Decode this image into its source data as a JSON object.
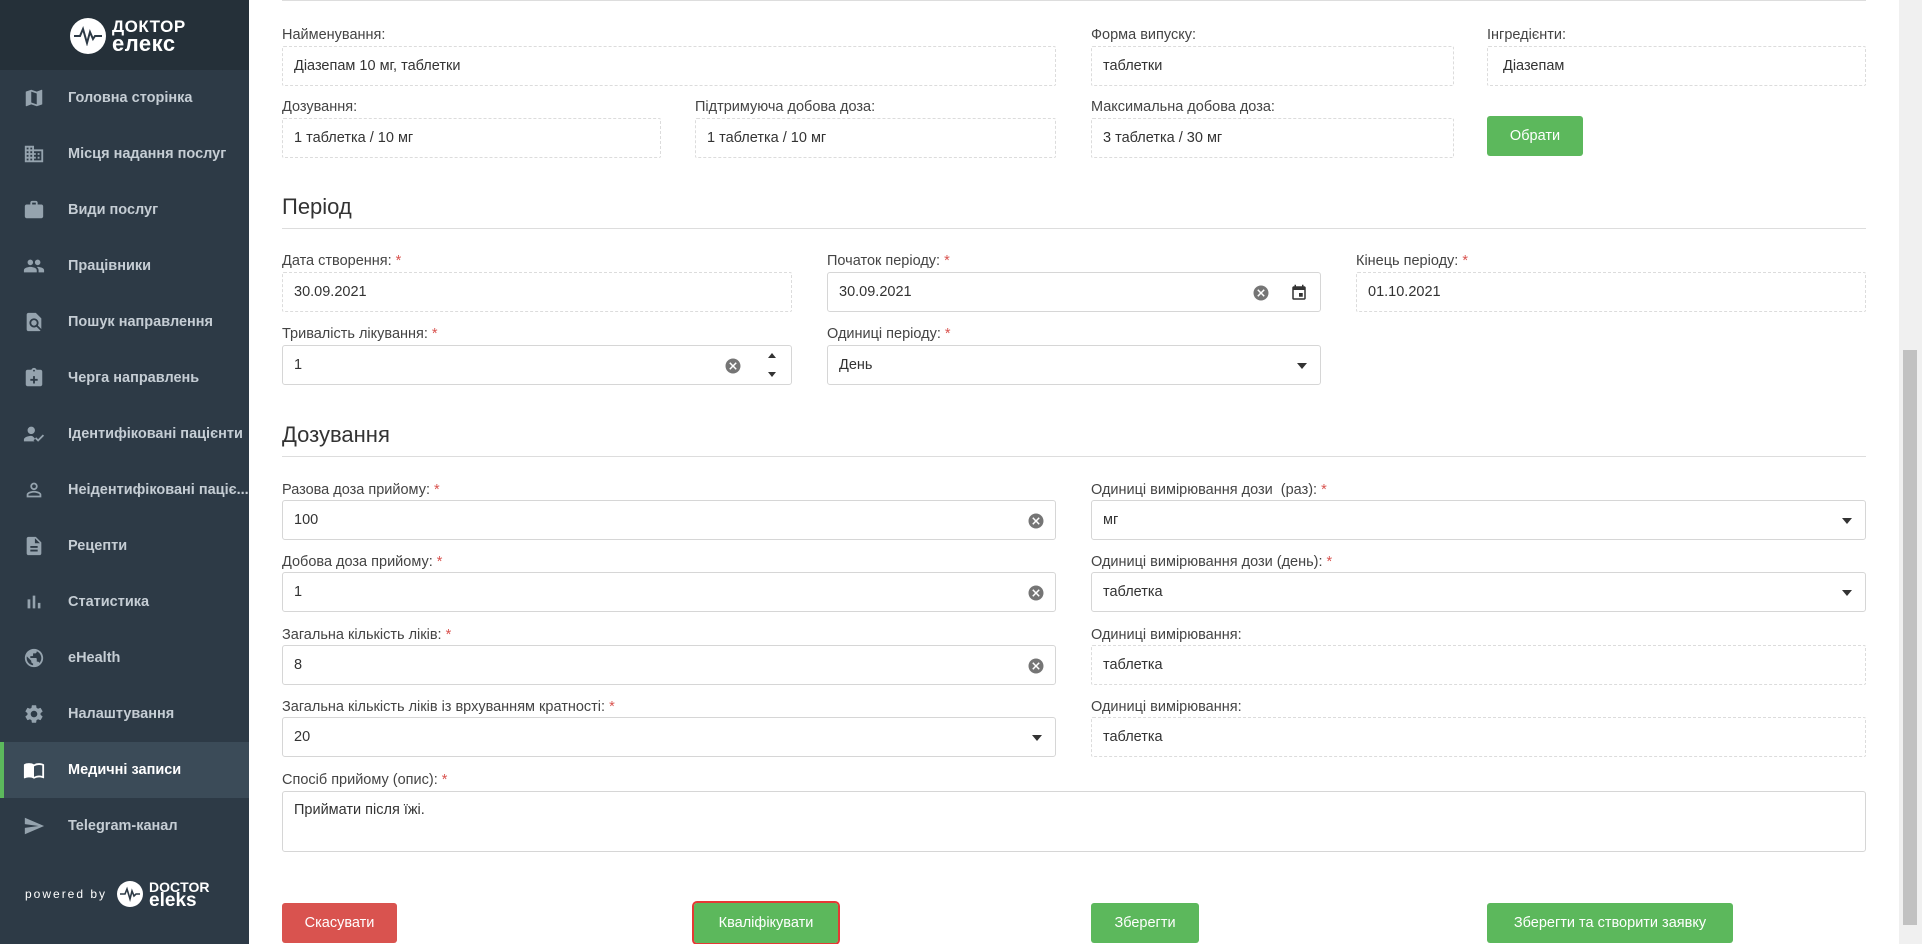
{
  "brand": {
    "line1": "ДОКТОР",
    "line2": "елекс",
    "powered_by": "powered by",
    "footer_line1": "DOCTOR",
    "footer_line2": "eleks"
  },
  "nav": [
    {
      "label": "Головна сторінка",
      "icon": "map-icon",
      "active": false
    },
    {
      "label": "Місця надання послуг",
      "icon": "building-icon",
      "active": false
    },
    {
      "label": "Види послуг",
      "icon": "briefcase-icon",
      "active": false
    },
    {
      "label": "Працівники",
      "icon": "people-icon",
      "active": false
    },
    {
      "label": "Пошук направлення",
      "icon": "document-search-icon",
      "active": false
    },
    {
      "label": "Черга направлень",
      "icon": "clipboard-plus-icon",
      "active": false
    },
    {
      "label": "Ідентифіковані пацієнти",
      "icon": "person-check-icon",
      "active": false
    },
    {
      "label": "Неідентифіковані паціє...",
      "icon": "person-outline-icon",
      "active": false
    },
    {
      "label": "Рецепти",
      "icon": "file-icon",
      "active": false
    },
    {
      "label": "Статистика",
      "icon": "bar-chart-icon",
      "active": false
    },
    {
      "label": "eHealth",
      "icon": "globe-icon",
      "active": false
    },
    {
      "label": "Налаштування",
      "icon": "gear-icon",
      "active": false
    },
    {
      "label": "Медичні записи",
      "icon": "book-icon",
      "active": true
    },
    {
      "label": "Telegram-канал",
      "icon": "send-icon",
      "active": false
    }
  ],
  "medicine": {
    "name_label": "Найменування:",
    "name_value": "Діазепам 10 мг, таблетки",
    "form_label": "Форма випуску:",
    "form_value": "таблетки",
    "ingredients_label": "Інгредієнти:",
    "ingredients_value": "Діазепам",
    "dosage_label": "Дозування:",
    "dosage_value": "1 таблетка / 10 мг",
    "maint_label": "Підтримуюча добова доза:",
    "maint_value": "1 таблетка / 10 мг",
    "max_label": "Максимальна добова доза:",
    "max_value": "3 таблетка / 30 мг",
    "choose_button": "Обрати"
  },
  "period": {
    "title": "Період",
    "created_label": "Дата створення:",
    "created_value": "30.09.2021",
    "start_label": "Початок періоду:",
    "start_value": "30.09.2021",
    "end_label": "Кінець періоду:",
    "end_value": "01.10.2021",
    "duration_label": "Тривалість лікування:",
    "duration_value": "1",
    "units_label": "Одиниці періоду:",
    "units_value": "День"
  },
  "dosing": {
    "title": "Дозування",
    "single_label": "Разова доза прийому:",
    "single_value": "100",
    "single_unit_label": "Одиниці вимірювання дози  (раз):",
    "single_unit_value": "мг",
    "daily_label": "Добова доза прийому:",
    "daily_value": "1",
    "daily_unit_label": "Одиниці вимірювання дози (день):",
    "daily_unit_value": "таблетка",
    "total_label": "Загальна кількість ліків:",
    "total_value": "8",
    "total_unit_label": "Одиниці вимірювання:",
    "total_unit_value": "таблетка",
    "total_mult_label": "Загальна кількість ліків із врхуванням кратності:",
    "total_mult_value": "20",
    "total_mult_unit_label": "Одиниці вимірювання:",
    "total_mult_unit_value": "таблетка",
    "method_label": "Спосіб прийому (опис):",
    "method_value": "Приймати після їжі."
  },
  "actions": {
    "cancel": "Скасувати",
    "qualify": "Кваліфікувати",
    "save": "Зберегти",
    "save_create": "Зберегти та створити заявку"
  },
  "colors": {
    "sidebar": "#2d3a46",
    "accent_green": "#5cb85c",
    "danger_red": "#d9534f"
  }
}
